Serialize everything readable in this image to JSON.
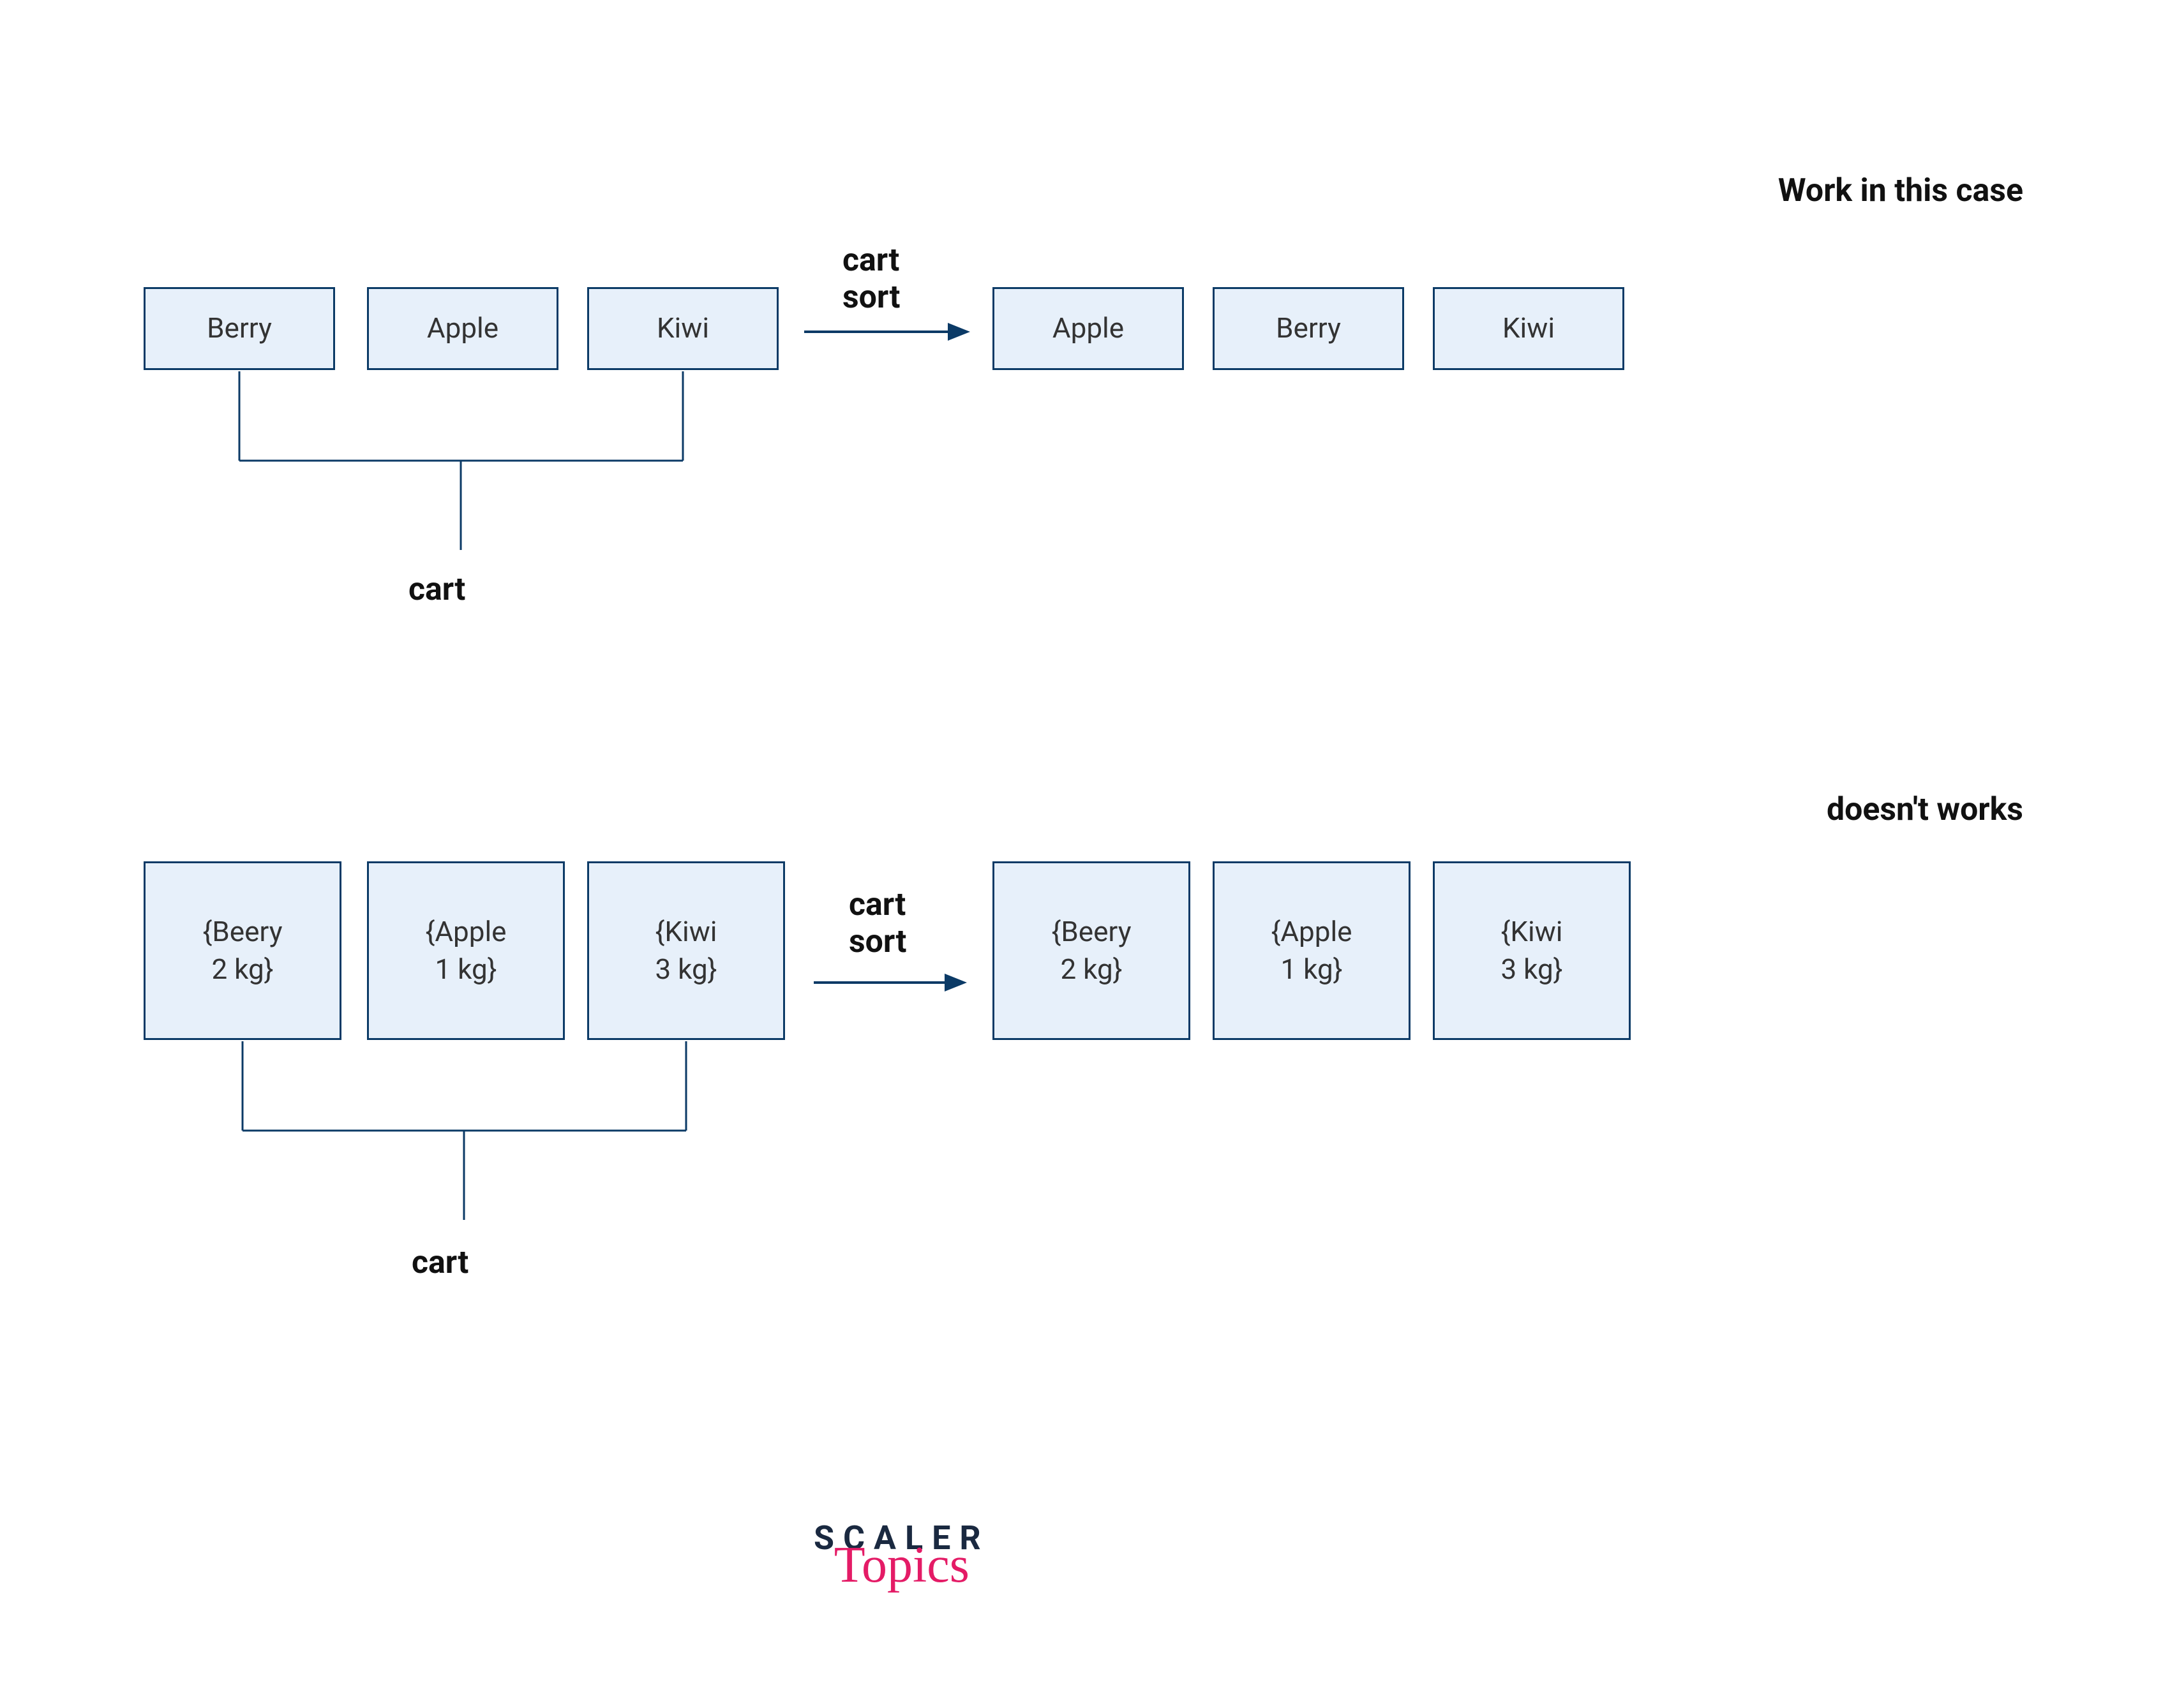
{
  "captions": {
    "works": "Work in this case",
    "doesnt": "doesn't works"
  },
  "arrow_label": {
    "line1": "cart",
    "line2": "sort"
  },
  "cart_label": "cart",
  "row1": {
    "left": [
      "Berry",
      "Apple",
      "Kiwi"
    ],
    "right": [
      "Apple",
      "Berry",
      "Kiwi"
    ]
  },
  "row2": {
    "left": [
      {
        "l1": "{Beery",
        "l2": "2 kg}"
      },
      {
        "l1": "{Apple",
        "l2": "1 kg}"
      },
      {
        "l1": "{Kiwi",
        "l2": "3 kg}"
      }
    ],
    "right": [
      {
        "l1": "{Beery",
        "l2": "2 kg}"
      },
      {
        "l1": "{Apple",
        "l2": "1 kg}"
      },
      {
        "l1": "{Kiwi",
        "l2": "3 kg}"
      }
    ]
  },
  "brand": {
    "top": "SCALER",
    "bottom": "Topics"
  }
}
